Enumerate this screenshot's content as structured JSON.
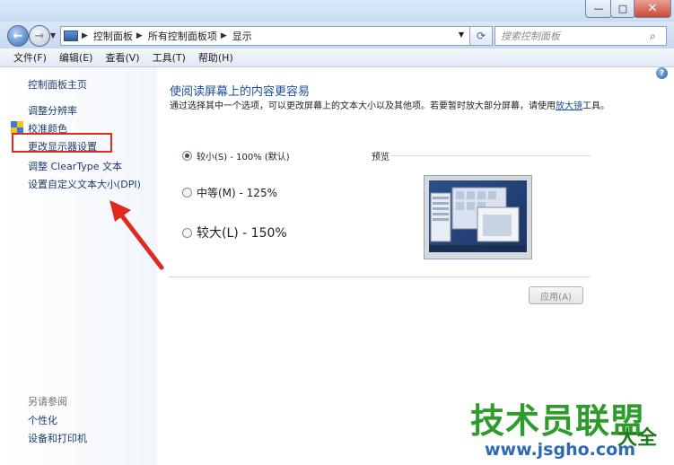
{
  "window": {
    "min_label": "—",
    "max_label": "□",
    "close_label": "✕"
  },
  "address": {
    "breadcrumbs": [
      "控制面板",
      "所有控制面板项",
      "显示"
    ],
    "search_placeholder": "搜索控制面板"
  },
  "menu": [
    "文件(F)",
    "编辑(E)",
    "查看(V)",
    "工具(T)",
    "帮助(H)"
  ],
  "sidebar": {
    "links": [
      "控制面板主页",
      "调整分辨率",
      "校准颜色",
      "更改显示器设置",
      "调整 ClearType 文本",
      "设置自定义文本大小(DPI)"
    ],
    "see_also_label": "另请参阅",
    "see_also": [
      "个性化",
      "设备和打印机"
    ]
  },
  "main": {
    "heading": "使阅读屏幕上的内容更容易",
    "desc_text": "通过选择其中一个选项，可以更改屏幕上的文本大小以及其他项。若要暂时放大部分屏幕，请使用",
    "desc_link": "放大镜",
    "desc_end": "工具。",
    "options": [
      {
        "label": "较小(S) - 100% (默认)",
        "selected": true
      },
      {
        "label": "中等(M) - 125%",
        "selected": false
      },
      {
        "label": "较大(L) - 150%",
        "selected": false
      }
    ],
    "preview_label": "预览",
    "apply_label": "应用(A)"
  },
  "watermark": {
    "text": "技术员联盟",
    "suffix": "大全",
    "url": "www.jsgho.com"
  },
  "colors": {
    "link": "#1f4e98",
    "highlight_box": "#e02a1f",
    "watermark_green": "#2e9c2a"
  }
}
